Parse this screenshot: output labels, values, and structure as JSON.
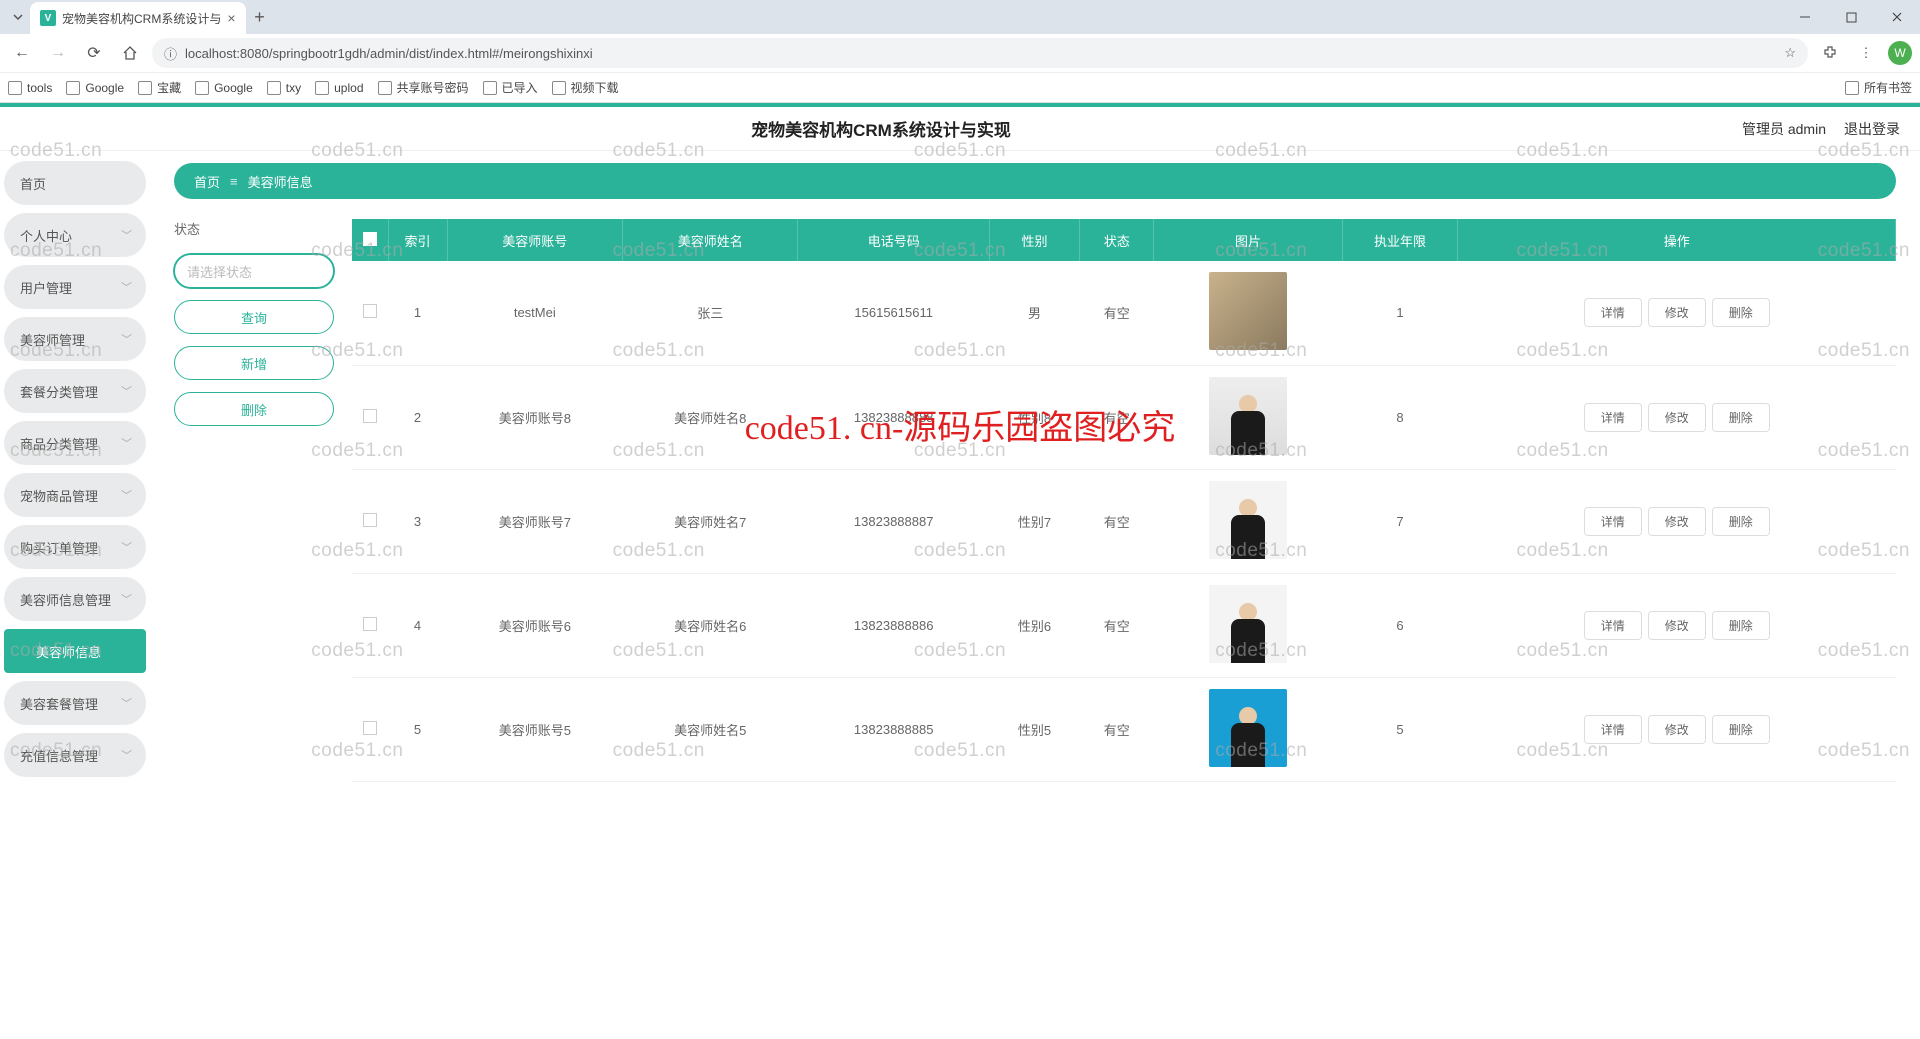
{
  "browser": {
    "tab_title": "宠物美容机构CRM系统设计与",
    "url": "localhost:8080/springbootr1gdh/admin/dist/index.html#/meirongshixinxi",
    "avatar_letter": "W",
    "bookmarks": [
      "tools",
      "Google",
      "宝藏",
      "Google",
      "txy",
      "uplod",
      "共享账号密码",
      "已导入",
      "视频下载"
    ],
    "all_bookmarks": "所有书签"
  },
  "app": {
    "title": "宠物美容机构CRM系统设计与实现",
    "user_label": "管理员 admin",
    "logout": "退出登录"
  },
  "sidebar": {
    "items": [
      {
        "label": "首页",
        "expandable": false
      },
      {
        "label": "个人中心",
        "expandable": true
      },
      {
        "label": "用户管理",
        "expandable": true
      },
      {
        "label": "美容师管理",
        "expandable": true
      },
      {
        "label": "套餐分类管理",
        "expandable": true
      },
      {
        "label": "商品分类管理",
        "expandable": true
      },
      {
        "label": "宠物商品管理",
        "expandable": true
      },
      {
        "label": "购买订单管理",
        "expandable": true
      },
      {
        "label": "美容师信息管理",
        "expandable": true
      },
      {
        "label": "美容师信息",
        "expandable": false,
        "sub": true
      },
      {
        "label": "美容套餐管理",
        "expandable": true
      },
      {
        "label": "充值信息管理",
        "expandable": true
      }
    ]
  },
  "breadcrumb": {
    "home": "首页",
    "current": "美容师信息"
  },
  "filters": {
    "status_label": "状态",
    "placeholder": "请选择状态",
    "query": "查询",
    "add": "新增",
    "delete": "删除"
  },
  "table": {
    "headers": [
      "索引",
      "美容师账号",
      "美容师姓名",
      "电话号码",
      "性别",
      "状态",
      "图片",
      "执业年限",
      "操作"
    ],
    "actions": {
      "detail": "详情",
      "edit": "修改",
      "delete": "删除"
    },
    "rows": [
      {
        "idx": "1",
        "account": "testMei",
        "name": "张三",
        "phone": "15615615611",
        "gender": "男",
        "status": "有空",
        "years": "1",
        "img": "p1"
      },
      {
        "idx": "2",
        "account": "美容师账号8",
        "name": "美容师姓名8",
        "phone": "13823888888",
        "gender": "性别8",
        "status": "有空",
        "years": "8",
        "img": "p2"
      },
      {
        "idx": "3",
        "account": "美容师账号7",
        "name": "美容师姓名7",
        "phone": "13823888887",
        "gender": "性别7",
        "status": "有空",
        "years": "7",
        "img": "p3"
      },
      {
        "idx": "4",
        "account": "美容师账号6",
        "name": "美容师姓名6",
        "phone": "13823888886",
        "gender": "性别6",
        "status": "有空",
        "years": "6",
        "img": "p4"
      },
      {
        "idx": "5",
        "account": "美容师账号5",
        "name": "美容师姓名5",
        "phone": "13823888885",
        "gender": "性别5",
        "status": "有空",
        "years": "5",
        "img": "p5"
      }
    ]
  },
  "watermark": {
    "small": "code51.cn",
    "big": "code51. cn-源码乐园盗图必究"
  }
}
